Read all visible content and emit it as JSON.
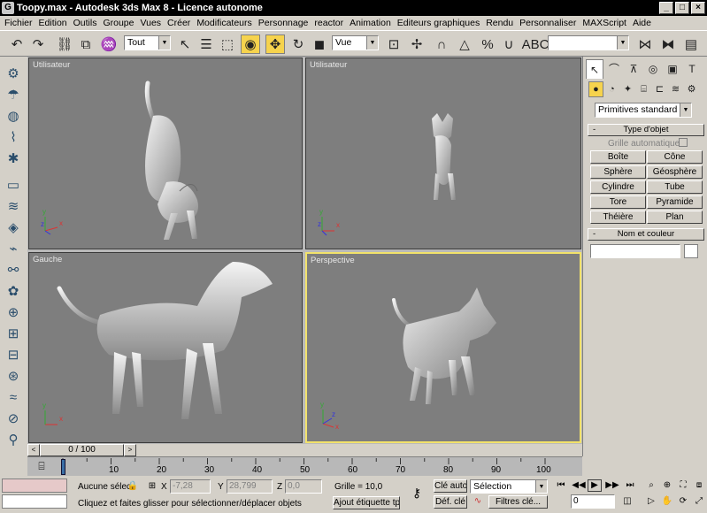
{
  "window": {
    "title": "Toopy.max - Autodesk 3ds Max 8 - Licence autonome",
    "app_icon": "3ds-max-icon"
  },
  "menu": [
    "Fichier",
    "Edition",
    "Outils",
    "Groupe",
    "Vues",
    "Créer",
    "Modificateurs",
    "Personnage",
    "reactor",
    "Animation",
    "Editeurs graphiques",
    "Rendu",
    "Personnaliser",
    "MAXScript",
    "Aide"
  ],
  "toolbar": {
    "selection_filter": "Tout",
    "reference_coord": "Vue",
    "named_selection": ""
  },
  "viewports": [
    {
      "label": "Utilisateur"
    },
    {
      "label": "Utilisateur"
    },
    {
      "label": "Gauche"
    },
    {
      "label": "Perspective"
    }
  ],
  "axes_labels": {
    "x": "x",
    "y": "y",
    "z": "z"
  },
  "command_panel": {
    "category_dropdown": "Primitives standard",
    "object_type": {
      "title": "Type d'objet",
      "autogrid_label": "Grille automatique",
      "buttons": [
        "Boîte",
        "Cône",
        "Sphère",
        "Géosphère",
        "Cylindre",
        "Tube",
        "Tore",
        "Pyramide",
        "Théière",
        "Plan"
      ]
    },
    "name_color": {
      "title": "Nom et couleur",
      "name_value": ""
    },
    "collapse_symbol": "-"
  },
  "time_slider": {
    "position_label": "0 / 100",
    "current_frame": 0,
    "total_frames": 100,
    "prev_label": "<",
    "next_label": ">"
  },
  "trackbar": {
    "tick_labels": [
      "10",
      "20",
      "30",
      "40",
      "50",
      "60",
      "70",
      "80",
      "90",
      "100"
    ]
  },
  "status": {
    "selection_text": "Aucune sélec",
    "x_label": "X",
    "x_value": "-7,28",
    "y_label": "Y",
    "y_value": "28,799",
    "z_label": "Z",
    "z_value": "0,0",
    "grid_text": "Grille = 10,0",
    "prompt_text": "Cliquez et faites glisser pour sélectionner/déplacer objets",
    "add_time_tag": "Ajout étiquette tps",
    "auto_key": "Clé auto",
    "set_key": "Déf. clé",
    "selection_dropdown": "Sélection",
    "key_filters": "Filtres clé...",
    "frame_value": "0"
  }
}
